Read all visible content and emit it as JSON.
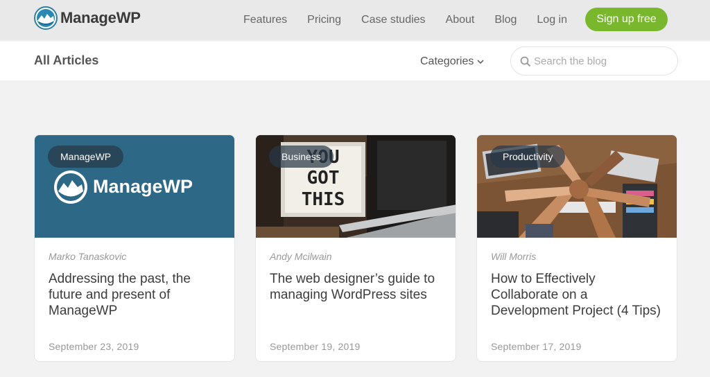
{
  "header": {
    "brand": "ManageWP",
    "nav": [
      "Features",
      "Pricing",
      "Case studies",
      "About",
      "Blog",
      "Log in"
    ],
    "signup": "Sign up free"
  },
  "subheader": {
    "title": "All Articles",
    "categories": "Categories",
    "search_placeholder": "Search the blog"
  },
  "articles": [
    {
      "category": "ManageWP",
      "image_brand": "ManageWP",
      "author": "Marko Tanaskovic",
      "title": "Addressing the past, the future and present of ManageWP",
      "date": "September 23, 2019"
    },
    {
      "category": "Business",
      "image_sign": [
        "YOU",
        "GOT",
        "THIS"
      ],
      "author": "Andy Mcilwain",
      "title": "The web designer’s guide to managing WordPress sites",
      "date": "September 19, 2019"
    },
    {
      "category": "Productivity",
      "author": "Will Morris",
      "title": "How to Effectively Collaborate on a Development Project (4 Tips)",
      "date": "September 17, 2019"
    }
  ],
  "colors": {
    "accent_green": "#79b72c",
    "brand_blue": "#2d6987",
    "header_bg": "#e9e9e9"
  }
}
